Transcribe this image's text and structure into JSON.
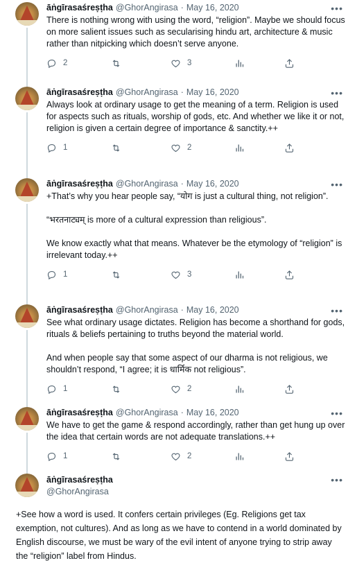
{
  "tweets": [
    {
      "name": "āṅgīrasaśreṣṭha",
      "handle": "@GhorAngirasa",
      "date": "May 16, 2020",
      "text": "There is nothing wrong with using the word, “religion”. Maybe we should focus on more salient issues such as secularising hindu art, architecture & music rather than nitpicking which doesn’t serve anyone.",
      "replies": "2",
      "retweets": "",
      "likes": "3"
    },
    {
      "name": "āṅgīrasaśreṣṭha",
      "handle": "@GhorAngirasa",
      "date": "May 16, 2020",
      "text": "Always look at ordinary usage to get the meaning of a term. Religion is used for aspects such as rituals, worship of gods, etc. And whether we like it or not, religion is given a certain degree of importance & sanctity.++",
      "replies": "1",
      "retweets": "",
      "likes": "2"
    },
    {
      "name": "āṅgīrasaśreṣṭha",
      "handle": "@GhorAngirasa",
      "date": "May 16, 2020",
      "text": "+That’s why you hear people say, “योग is just a cultural thing, not religion”.\n\n“भरतनाट्यम् is more of a cultural expression than religious”.\n\nWe know exactly what that means. Whatever be the etymology of “religion” is irrelevant today.++",
      "replies": "1",
      "retweets": "",
      "likes": "3"
    },
    {
      "name": "āṅgīrasaśreṣṭha",
      "handle": "@GhorAngirasa",
      "date": "May 16, 2020",
      "text": "See what ordinary usage dictates. Religion has become a shorthand for gods, rituals & beliefs pertaining to truths beyond the material world.\n\nAnd when people say that some aspect of our dharma is not religious, we shouldn’t respond, “I agree; it is धार्मिक not religious”.",
      "replies": "1",
      "retweets": "",
      "likes": "2"
    },
    {
      "name": "āṅgīrasaśreṣṭha",
      "handle": "@GhorAngirasa",
      "date": "May 16, 2020",
      "text": "We have to get the game & respond accordingly, rather than get hung up over the idea that certain words are not adequate translations.++",
      "replies": "1",
      "retweets": "",
      "likes": "2"
    }
  ],
  "main_tweet": {
    "name": "āṅgīrasaśreṣṭha",
    "handle": "@GhorAngirasa",
    "text": "+See how a word is used. It confers certain privileges (Eg. Religions get tax exemption, not cultures). And as long as we have to contend in a world dominated by English discourse, we must be wary of the evil intent of anyone trying to strip away the “religion” label from Hindus."
  },
  "ui": {
    "separator": "·",
    "more_glyph": "•••"
  },
  "icons": [
    "reply-icon",
    "retweet-icon",
    "like-icon",
    "views-icon",
    "share-icon",
    "more-icon"
  ]
}
